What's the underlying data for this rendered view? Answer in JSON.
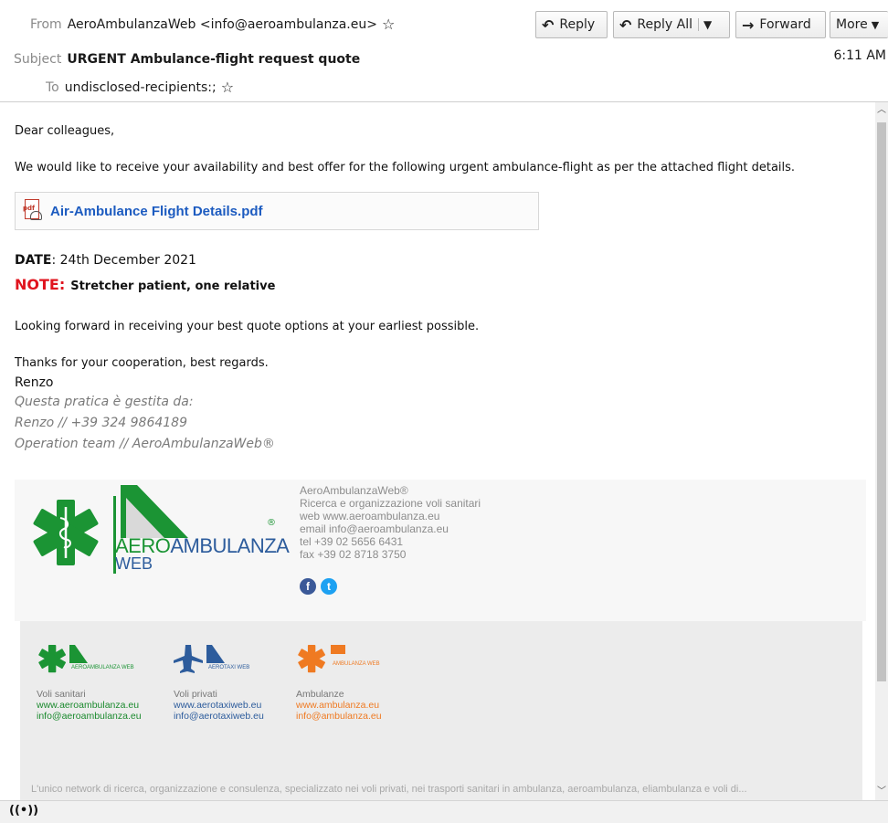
{
  "header": {
    "from_label": "From",
    "from_value": "AeroAmbulanzaWeb <info@aeroambulanza.eu>",
    "subject_label": "Subject",
    "subject_value": "URGENT Ambulance-flight request quote",
    "to_label": "To",
    "to_value": "undisclosed-recipients:;",
    "time": "6:11 AM",
    "star_icon": "star-outline-icon"
  },
  "toolbar": {
    "reply_label": "Reply",
    "reply_all_label": "Reply All",
    "forward_label": "Forward",
    "more_label": "More"
  },
  "message": {
    "greeting": "Dear colleagues,",
    "intro": "We would like to receive your availability and best offer for the following urgent ambulance-flight as per the attached flight details.",
    "attachment_name": "Air-Ambulance Flight Details.pdf",
    "date_label": "DATE",
    "date_value": ": 24th December 2021",
    "note_label": "NOTE:",
    "note_value": "Stretcher patient, one relative",
    "closing_1": "Looking forward in receiving your best quote options at your earliest possible.",
    "closing_2": "Thanks for your cooperation, best regards.",
    "signer": "Renzo",
    "sig_line_1": "Questa pratica è gestita da:",
    "sig_line_2": "Renzo // +39 324 9864189",
    "sig_line_3": "Operation team // AeroAmbulanzaWeb®"
  },
  "banner": {
    "logo_word_1a": "AERO",
    "logo_word_1b": "AMBULANZA",
    "logo_word_2": "WEB",
    "logo_reg": "®",
    "info_1": "AeroAmbulanzaWeb®",
    "info_2": "Ricerca e organizzazione voli sanitari",
    "info_3": "web www.aeroambulanza.eu",
    "info_4": "email info@aeroambulanza.eu",
    "info_5": "tel +39 02 5656 6431",
    "info_6": "fax +39 02 8718 3750"
  },
  "footer": {
    "col1_title": "Voli sanitari",
    "col1_web": "www.aeroambulanza.eu",
    "col1_mail": "info@aeroambulanza.eu",
    "col2_title": "Voli privati",
    "col2_web": "www.aerotaxiweb.eu",
    "col2_mail": "info@aerotaxiweb.eu",
    "col3_title": "Ambulanze",
    "col3_web": "www.ambulanza.eu",
    "col3_mail": "info@ambulanza.eu",
    "col1_logo_text": "AEROAMBULANZA WEB",
    "col2_logo_text": "AEROTAXI WEB",
    "col3_logo_text": "AMBULANZA WEB",
    "tagline": "L'unico network di ricerca, organizzazione e consulenza, specializzato nei voli privati, nei trasporti sanitari in ambulanza, aeroambulanza, eliambulanza e voli di..."
  },
  "colors": {
    "accent_green": "#1b9434",
    "accent_blue": "#2d5c9c",
    "accent_orange": "#ef7a22",
    "link_blue": "#1c5bc0",
    "note_red": "#e0141e"
  },
  "icons": {
    "facebook": "facebook-icon",
    "twitter": "twitter-icon",
    "status": "online-status-icon"
  }
}
